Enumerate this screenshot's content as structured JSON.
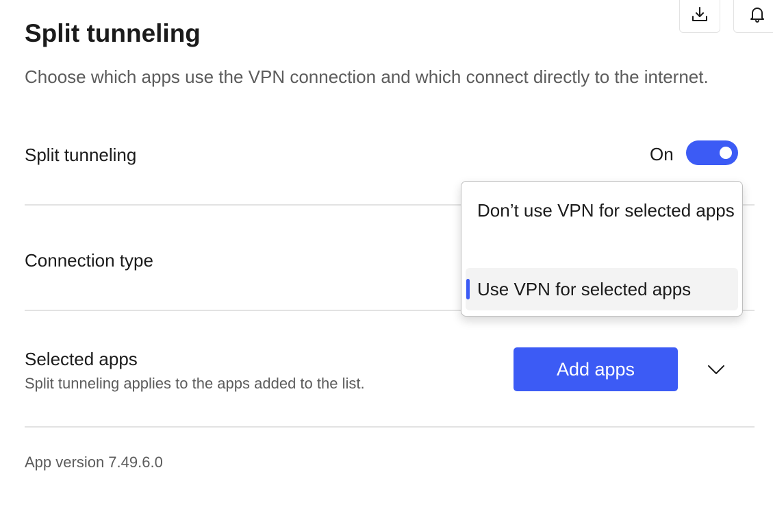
{
  "toolbar": {
    "download_icon": "download-icon",
    "notifications_icon": "bell-icon"
  },
  "header": {
    "title": "Split tunneling",
    "subtitle": "Choose which apps use the VPN connection and which connect directly to the internet."
  },
  "settings": {
    "split_tunneling": {
      "label": "Split tunneling",
      "state_label": "On",
      "enabled": true
    },
    "connection_type": {
      "label": "Connection type",
      "options": [
        "Don’t use VPN for selected apps",
        "Use VPN for selected apps"
      ],
      "selected": "Use VPN for selected apps"
    },
    "selected_apps": {
      "label": "Selected apps",
      "description": "Split tunneling applies to the apps added to the list.",
      "add_button": "Add apps",
      "expand_icon": "chevron-down-icon"
    }
  },
  "footer": {
    "version": "App version 7.49.6.0"
  },
  "colors": {
    "accent": "#3c5bf5",
    "text": "#1b1b1b",
    "muted": "#5c5c5c",
    "divider": "#e2e2e2"
  }
}
